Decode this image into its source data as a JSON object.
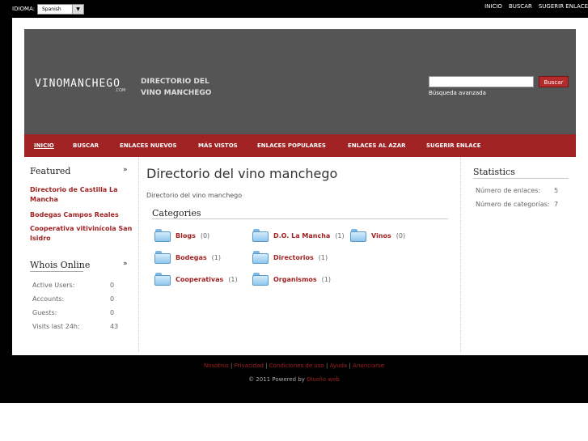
{
  "topbar": {
    "language_label": "IDIOMA:",
    "language_value": "Spanish",
    "nav": [
      "INICIO",
      "BUSCAR",
      "SUGERIR ENLACE"
    ]
  },
  "header": {
    "logo": "VINOMANCHEGO",
    "logo_sub": ".COM",
    "tagline_1": "DIRECTORIO DEL",
    "tagline_2": "VINO MANCHEGO",
    "search_button": "Buscar",
    "advanced_search": "Búsqueda avanzada"
  },
  "nav": {
    "items": [
      "INICIO",
      "BUSCAR",
      "ENLACES NUEVOS",
      "MÁS VISTOS",
      "ENLACES POPULARES",
      "ENLACES AL AZAR",
      "SUGERIR ENLACE"
    ]
  },
  "featured": {
    "title": "Featured",
    "links": [
      "Directorio de Castilla La Mancha",
      "Bodegas Campos Reales",
      "Cooperativa vitivinícola San Isidro"
    ]
  },
  "whois": {
    "title": "Whois Online",
    "rows": [
      {
        "label": "Active Users:",
        "value": "0"
      },
      {
        "label": "Accounts:",
        "value": "0"
      },
      {
        "label": "Guests:",
        "value": "0"
      },
      {
        "label": "Visits last 24h:",
        "value": "43"
      }
    ]
  },
  "main": {
    "title": "Directorio del vino manchego",
    "description": "Directorio del vino manchego",
    "categories_title": "Categories",
    "categories": [
      {
        "name": "Blogs",
        "count": "(0)"
      },
      {
        "name": "D.O. La Mancha",
        "count": "(1)"
      },
      {
        "name": "Vinos",
        "count": "(0)"
      },
      {
        "name": "Bodegas",
        "count": "(1)"
      },
      {
        "name": "Directorios",
        "count": "(1)"
      },
      {
        "name": "Cooperativas",
        "count": "(1)"
      },
      {
        "name": "Organismos",
        "count": "(1)"
      }
    ]
  },
  "stats": {
    "title": "Statistics",
    "rows": [
      {
        "label": "Número de enlaces:",
        "value": "5"
      },
      {
        "label": "Número de categorías:",
        "value": "7"
      }
    ]
  },
  "footer": {
    "links": [
      "Nosotros",
      "Privacidad",
      "Condiciones de uso",
      "Ayuda",
      "Anunciarse"
    ],
    "copyright": "© 2011 Powered by",
    "powered_link": "Diseño web"
  },
  "colors": {
    "accent": "#a02222",
    "header_bg": "#555555",
    "frame": "#000000"
  }
}
